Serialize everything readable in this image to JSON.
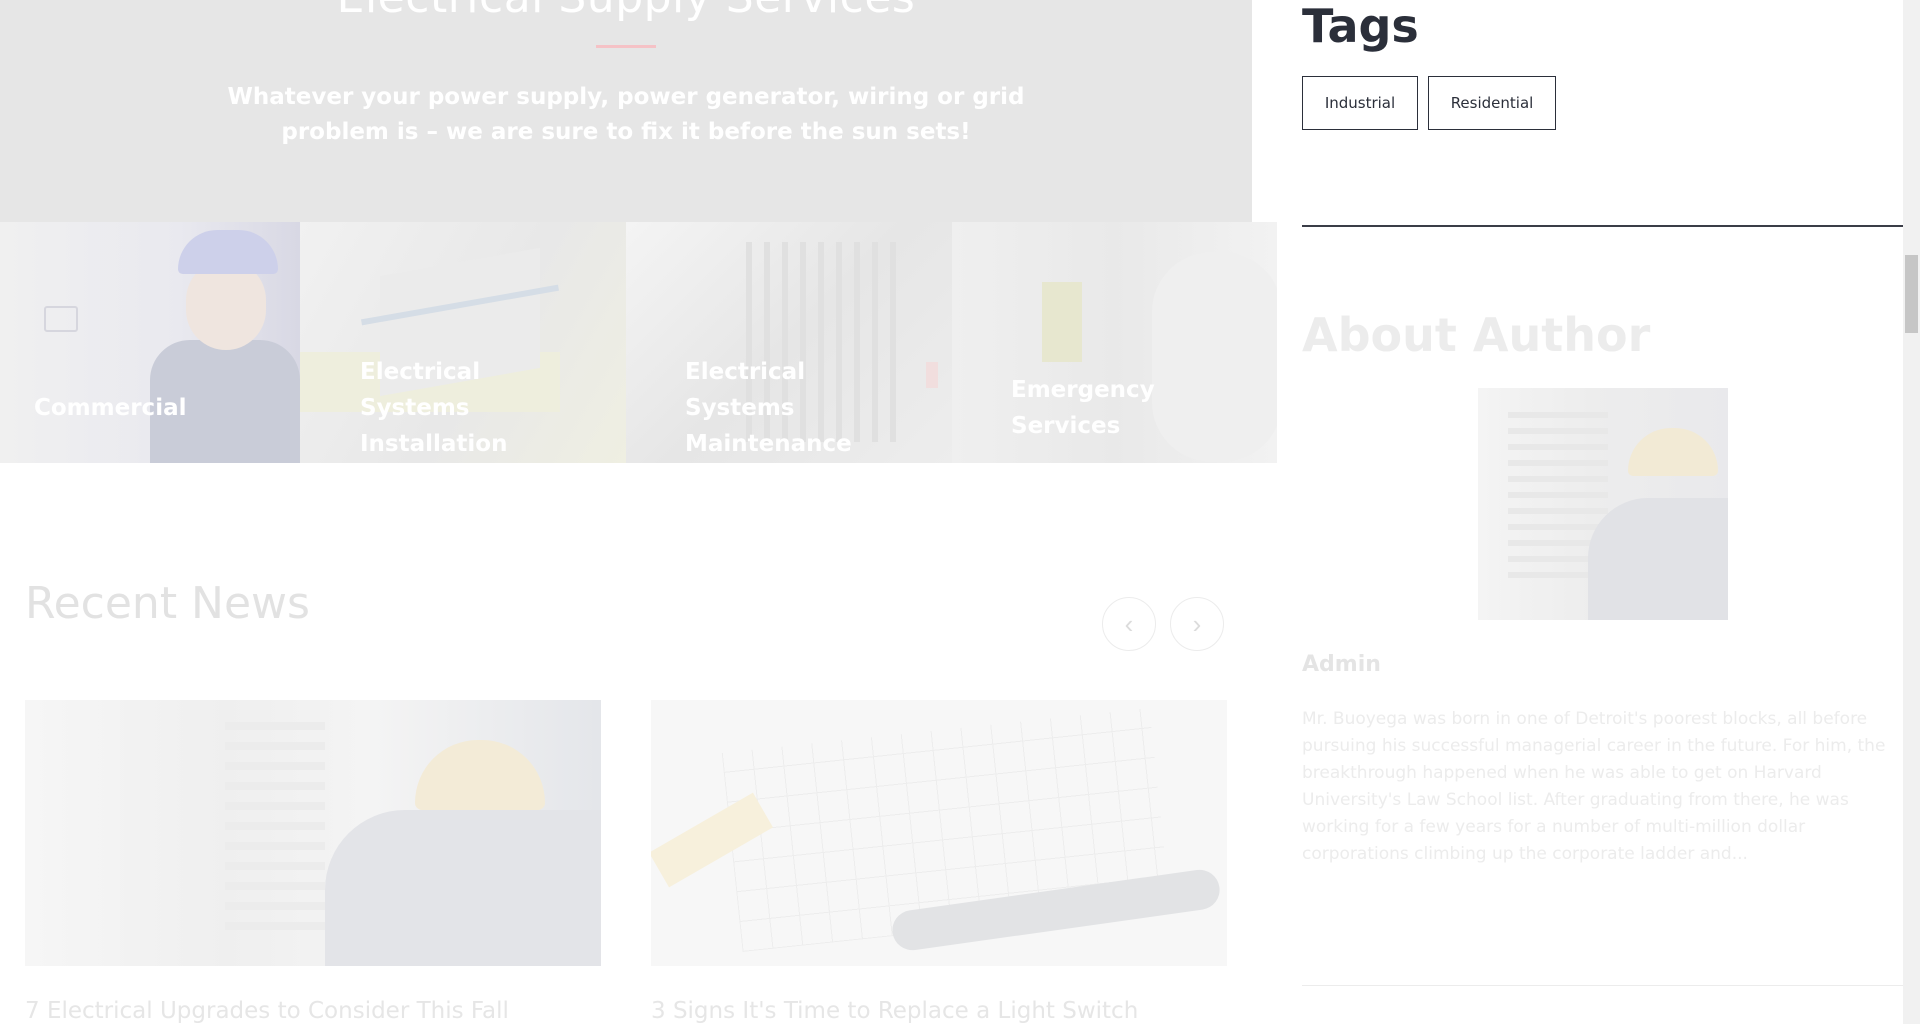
{
  "hero": {
    "title": "Electrical Supply Services",
    "description": "Whatever your power supply, power generator, wiring or grid problem is – we are sure to fix it before the sun sets!"
  },
  "services": [
    {
      "label": "Commercial"
    },
    {
      "label": "Electrical Systems Installation"
    },
    {
      "label": "Electrical Systems Maintenance"
    },
    {
      "label": "Emergency Services"
    }
  ],
  "news": {
    "title": "Recent News",
    "prev_icon": "‹",
    "next_icon": "›",
    "articles": [
      {
        "title": "7 Electrical Upgrades to Consider This Fall"
      },
      {
        "title": "3 Signs It's Time to Replace a Light Switch"
      }
    ]
  },
  "sidebar": {
    "tags_title": "Tags",
    "tags": [
      "Industrial",
      "Residential"
    ],
    "about_title": "About Author",
    "author_name": "Admin",
    "author_bio": "Mr. Buoyega was born in one of Detroit's poorest blocks, all before pursuing his successful managerial career in the future. For him, the breakthrough happened when he was able to get on Harvard University's Law School list. After graduating from there, he was working for a few years for a number of multi-million dollar corporations climbing up the corporate ladder and..."
  },
  "colors": {
    "heading_dark": "#2b2f3a",
    "hero_bg": "#e6e6e6",
    "accent_divider": "#f5c2c6"
  }
}
